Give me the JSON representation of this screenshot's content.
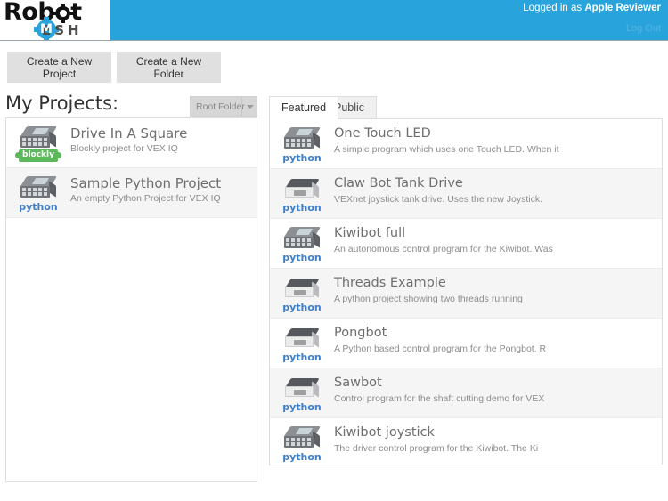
{
  "header": {
    "logo": {
      "word_top": "Robot",
      "word_bottom": "ESH",
      "gear_letter": "M"
    },
    "login_prefix": "Logged in as ",
    "login_user": "Apple Reviewer",
    "logout_label": "Log Out",
    "accent_color": "#29a3dc"
  },
  "toolbar": {
    "new_project_label": "Create a New Project",
    "new_folder_label": "Create a New Folder"
  },
  "my_projects": {
    "title": "My Projects:",
    "folder_dropdown_value": "Root Folder",
    "items": [
      {
        "title": "Drive In A Square",
        "description": "Blockly project for VEX IQ",
        "icon": "vexiq-brain-icon",
        "badge": "blockly",
        "badge_label": "blockly"
      },
      {
        "title": "Sample Python Project",
        "description": "An empty Python Project for VEX IQ",
        "icon": "vexiq-brain-icon",
        "badge": "python",
        "badge_label": "python"
      }
    ]
  },
  "browser": {
    "tabs": [
      {
        "label": "Featured",
        "active": true
      },
      {
        "label": "Public",
        "active": false
      }
    ],
    "items": [
      {
        "title": "One Touch LED",
        "description": "A simple program which uses one Touch LED. When it",
        "icon": "vexiq-brain-icon",
        "badge": "python",
        "badge_label": "python"
      },
      {
        "title": "Claw Bot Tank Drive",
        "description": "VEXnet joystick tank drive. Uses the new Joystick.",
        "icon": "cortex-icon",
        "badge": "python",
        "badge_label": "python"
      },
      {
        "title": "Kiwibot full",
        "description": "An autonomous control program for the Kiwibot. Was",
        "icon": "vexiq-brain-icon",
        "badge": "python",
        "badge_label": "python"
      },
      {
        "title": "Threads Example",
        "description": "A python project showing two threads running",
        "icon": "cortex-icon",
        "badge": "python",
        "badge_label": "python"
      },
      {
        "title": "Pongbot",
        "description": "A Python based control program for the Pongbot. R",
        "icon": "cortex-icon",
        "badge": "python",
        "badge_label": "python"
      },
      {
        "title": "Sawbot",
        "description": "Control program for the shaft cutting demo for VEX",
        "icon": "cortex-icon",
        "badge": "python",
        "badge_label": "python"
      },
      {
        "title": "Kiwibot joystick",
        "description": "The driver control program for the Kiwibot. The Ki",
        "icon": "vexiq-brain-icon",
        "badge": "python",
        "badge_label": "python"
      }
    ]
  }
}
